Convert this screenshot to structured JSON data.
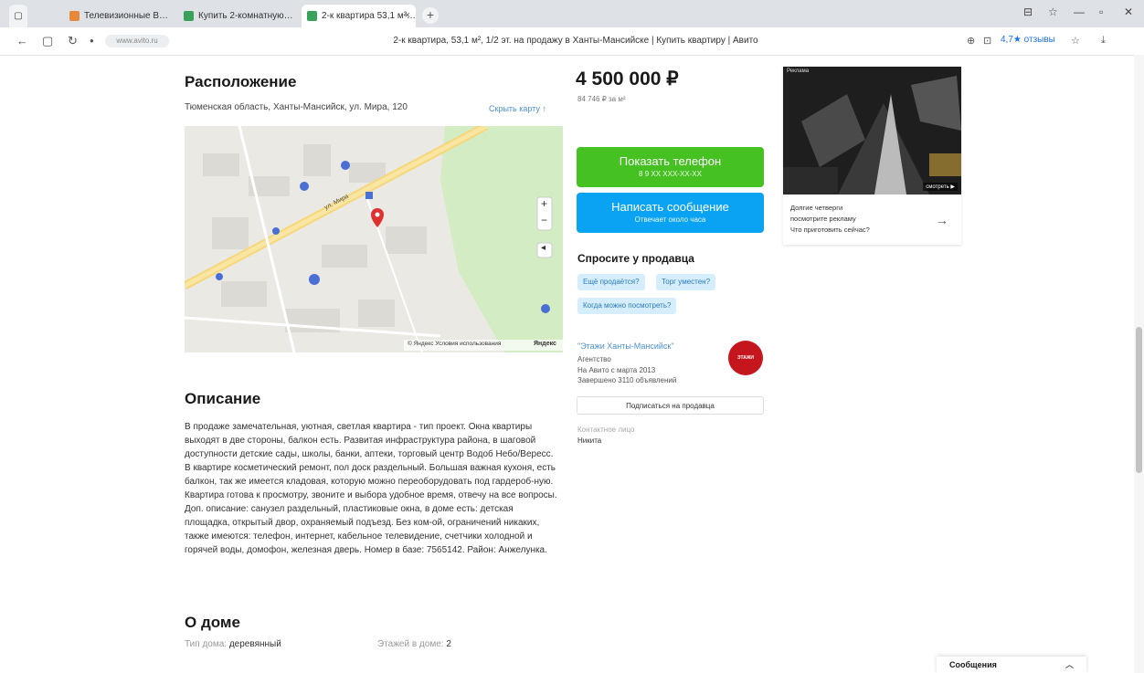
{
  "browser": {
    "tabs": [
      {
        "label": "Телевизионные В…",
        "fav_color": "#e8883a"
      },
      {
        "label": "Купить 2-комнатную…",
        "fav_color": "#3aa15a"
      },
      {
        "label": "2-к квартира 53,1 м²…",
        "fav_color": "#3aa15a"
      }
    ],
    "tab_close": "×",
    "new_tab": "+",
    "window_controls": [
      "⊟",
      "☆",
      "—",
      "▫",
      "✕"
    ],
    "url_text": "www.avito.ru",
    "page_title": "2-к квартира, 53,1 м², 1/2 эт. на продажу в Ханты-Мансийске | Купить квартиру | Авито",
    "rating_text": "4,7★ отзывы",
    "nav_icons": {
      "back": "←",
      "sidebar": "▢",
      "reload": "↻",
      "lock": "●"
    },
    "right_icons": [
      "⊕",
      "⊡",
      "☆",
      "⤓"
    ]
  },
  "location": {
    "title": "Расположение",
    "address": "Тюменская область, Ханты-Мансийск, ул. Мира, 120",
    "show_map": "Скрыть карту ↑",
    "map": {
      "street_label": "ул. Мира",
      "zoom_in": "+",
      "zoom_out": "−",
      "locate": "◂",
      "attribution": "© Яндекс Условия использования",
      "yandex": "Яндекс"
    }
  },
  "description": {
    "title": "Описание",
    "text": "В продаже замечательная, уютная, светлая квартира - тип проект. Окна квартиры выходят в две стороны, балкон есть. Развитая инфраструктура района, в шаговой доступности детские сады, школы, банки, аптеки, торговый центр Водоб Небо/Вересс. В квартире косметический ремонт, пол доск раздельный. Большая важная кухоня, есть балкон, так же имеется кладовая, которую можно переоборудовать под гардероб-ную. Квартира готова к просмотру, звоните и выбора удобное время, отвечу на все вопросы.\nДоп. описание: санузел раздельный, пластиковые окна, в доме есть: детская площадка, открытый двор, охраняемый подъезд. Без ком-ой, ограничений никаких, также имеются: телефон, интернет, кабельное телевидение, счетчики холодной и горячей воды, домофон, железная дверь. Номер в базе: 7565142. Район: Анжелунка."
  },
  "house": {
    "title": "О доме",
    "type_label": "Тип дома:",
    "type_value": "деревянный",
    "floors_label": "Этажей в доме:",
    "floors_value": "2"
  },
  "listing": {
    "price": "4 500 000 ₽",
    "price_sub": "84 746 ₽ за м²",
    "show_phone": "Показать телефон",
    "show_phone_sub": "8 9 ХХ ХХХ-ХХ-ХХ",
    "write_message": "Написать сообщение",
    "write_message_sub": "Отвечает около часа",
    "ask_title": "Спросите у продавца",
    "chips": [
      "Ещё продаётся?",
      "Торг уместен?",
      "Когда можно посмотреть?"
    ]
  },
  "seller": {
    "name": "\"Этажи Ханты-Мансийск\"",
    "role": "Агентство",
    "since": "На Авито с марта 2013",
    "closed": "Завершено 3110 объявлений",
    "logo_text": "ЭТАЖИ",
    "subscribe": "Подписаться на продавца",
    "contact_label": "Контактное лицо",
    "contact_value": "Никита"
  },
  "ad": {
    "label": "Реклама",
    "tag": "смотреть ▶",
    "text": "Долгие четверги\nпосмотрите рекламу\nЧто приготовить сейчас?",
    "arrow": "→"
  },
  "messages": {
    "label": "Сообщения",
    "chevron": "︿"
  },
  "colors": {
    "green": "#45c122",
    "blue": "#0aa3f3",
    "chip_bg": "#d6eefc",
    "link": "#4a90d9"
  }
}
